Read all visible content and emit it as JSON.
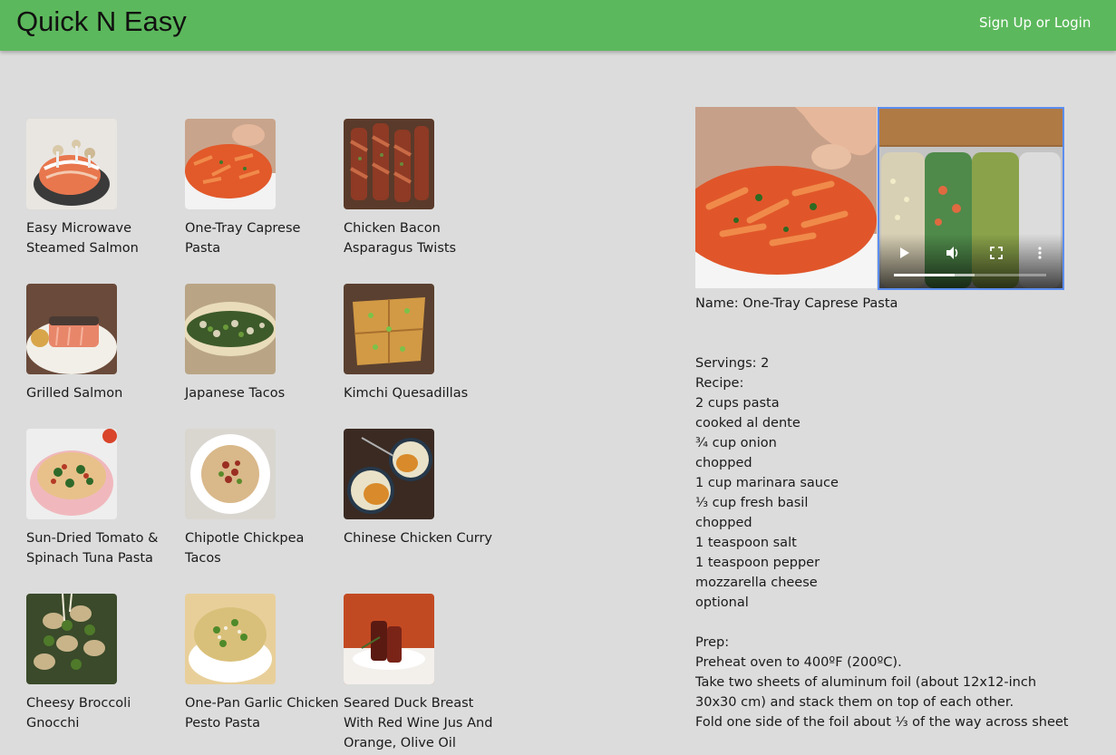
{
  "header": {
    "brand": "Quick N Easy",
    "login_label": "Sign Up or Login"
  },
  "recipes": [
    {
      "title": "Easy Microwave Steamed Salmon"
    },
    {
      "title": "One-Tray Caprese Pasta"
    },
    {
      "title": "Chicken Bacon Asparagus Twists"
    },
    {
      "title": "Grilled Salmon"
    },
    {
      "title": "Japanese Tacos"
    },
    {
      "title": "Kimchi Quesadillas"
    },
    {
      "title": "Sun-Dried Tomato & Spinach Tuna Pasta"
    },
    {
      "title": "Chipotle Chickpea Tacos"
    },
    {
      "title": "Chinese Chicken Curry"
    },
    {
      "title": "Cheesy Broccoli Gnocchi"
    },
    {
      "title": "One-Pan Garlic Chicken Pesto Pasta"
    },
    {
      "title": "Seared Duck Breast With Red Wine Jus And Orange, Olive Oil"
    }
  ],
  "detail": {
    "name_line": "Name: One-Tray Caprese Pasta",
    "servings_line": "Servings: 2",
    "recipe_label": "Recipe:",
    "ingredients": [
      "2 cups pasta",
      "cooked al dente",
      "¾ cup onion",
      "chopped",
      "1 cup marinara sauce",
      "⅓ cup fresh basil",
      "chopped",
      "1 teaspoon salt",
      "1 teaspoon pepper",
      "mozzarella cheese",
      "optional"
    ],
    "prep_label": "Prep:",
    "prep_steps": [
      "Preheat oven to 400ºF (200ºC).",
      "Take two sheets of aluminum foil (about 12x12-inch",
      "30x30 cm) and stack them on top of each other.",
      "Fold one side of the foil about ⅓ of the way across sheet"
    ],
    "video": {
      "played_fraction": 0.4,
      "loaded_fraction": 0.53
    }
  },
  "colors": {
    "navbar": "#5cb85c",
    "background": "#dcdcdc",
    "video_focus": "#5b8def"
  }
}
